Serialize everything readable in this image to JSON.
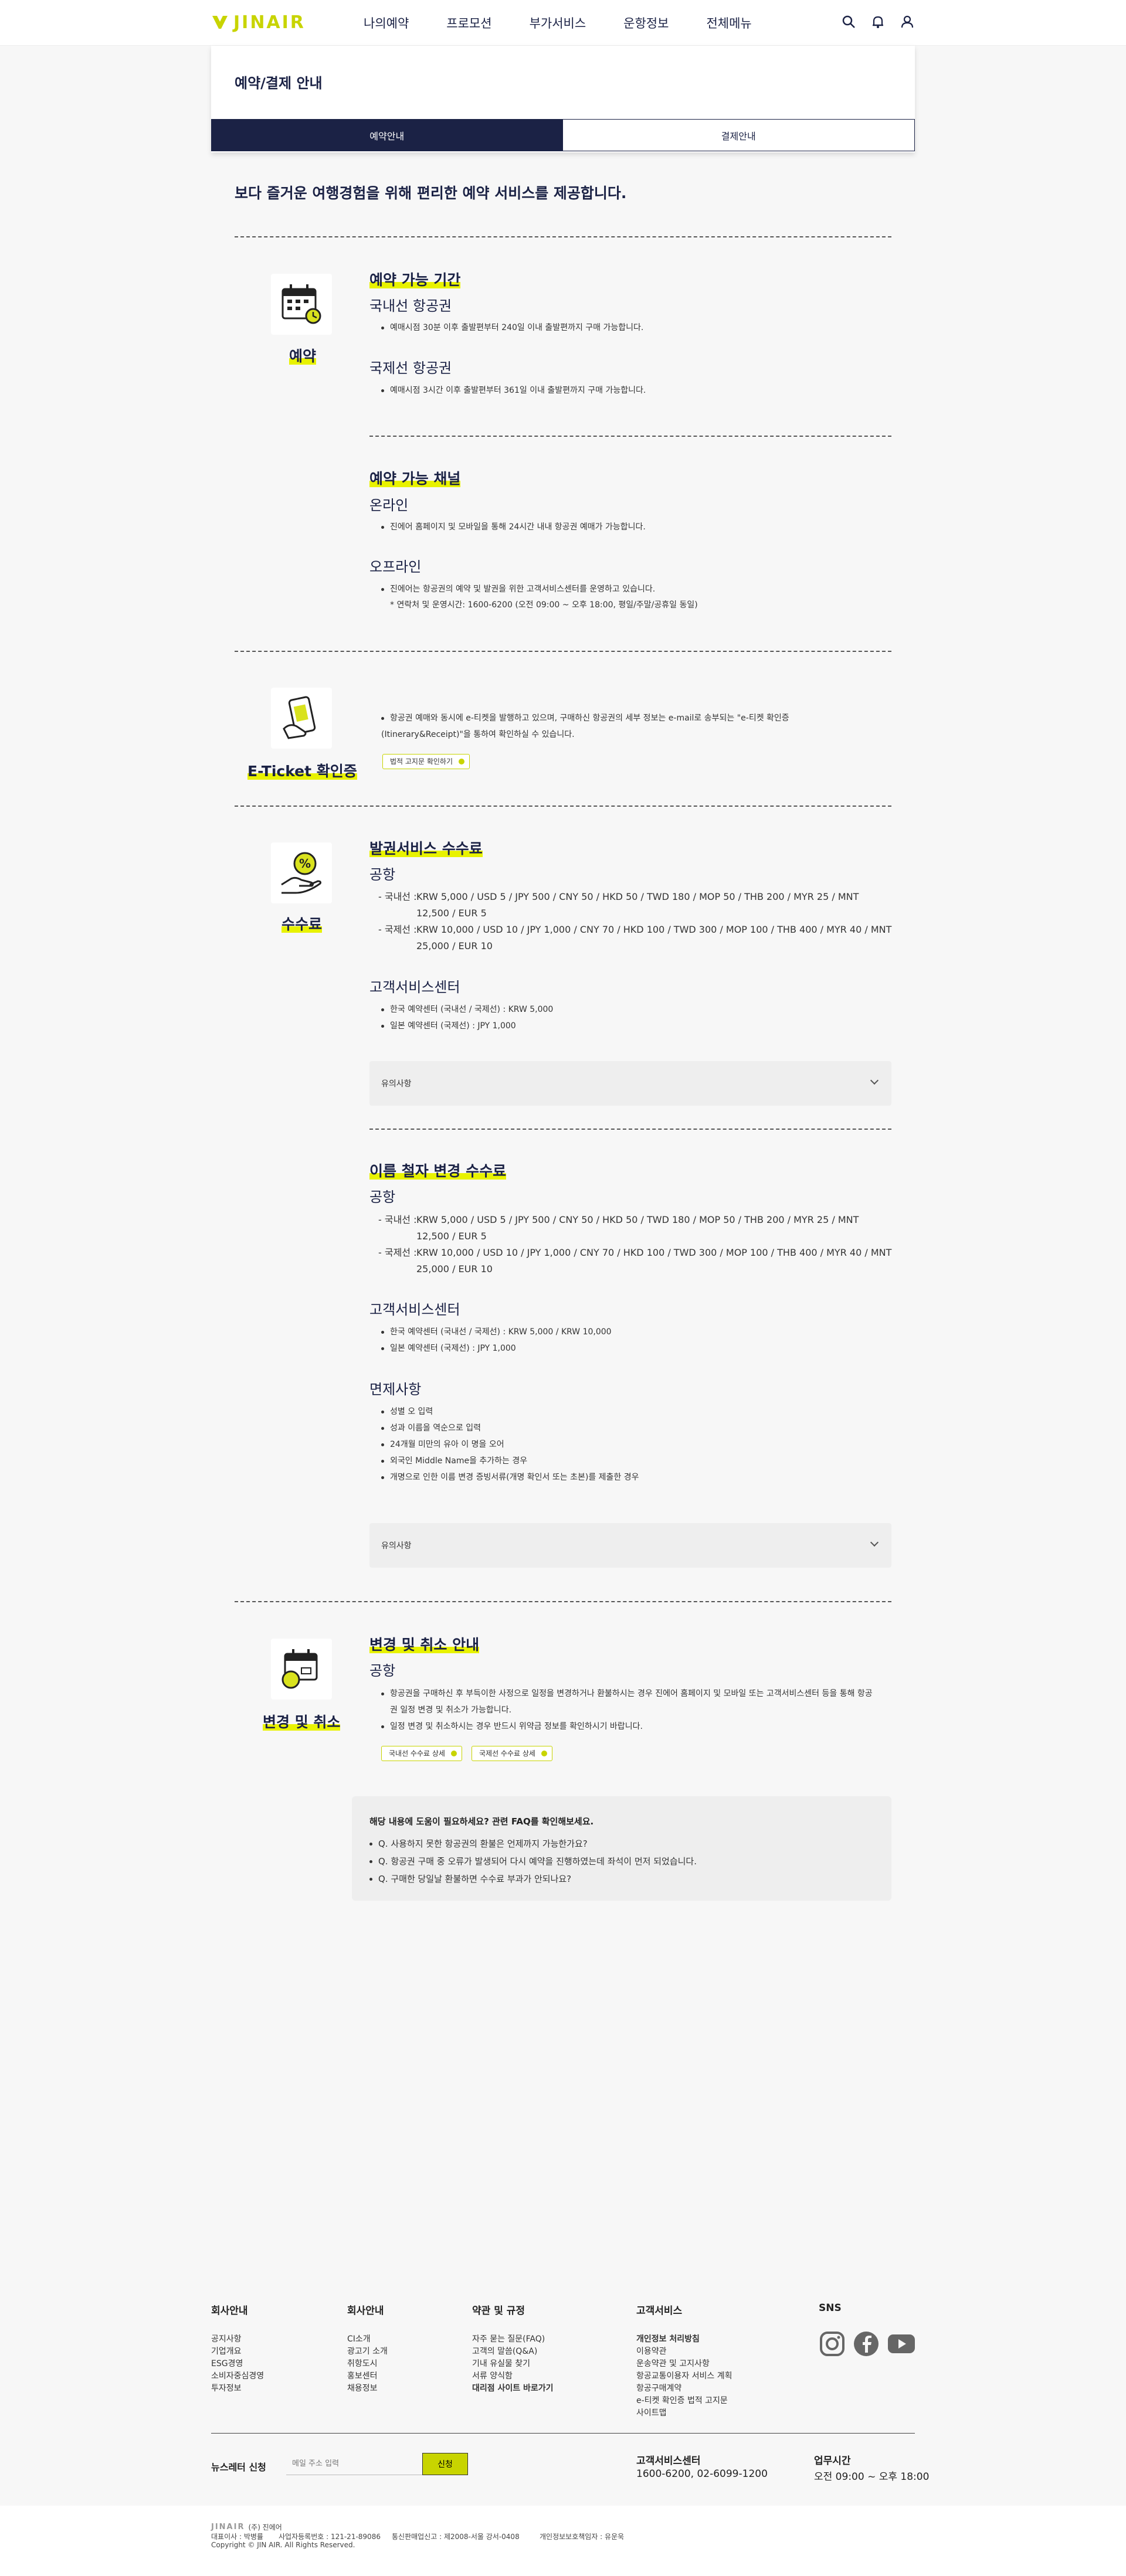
{
  "header": {
    "logo": "JINAIR",
    "nav": [
      "나의예약",
      "프로모션",
      "부가서비스",
      "운항정보",
      "전체메뉴"
    ],
    "icons": [
      "search-icon",
      "bell-icon",
      "user-icon"
    ]
  },
  "page": {
    "title": "예약/결제 안내",
    "tabs": [
      "예약안내",
      "결제안내"
    ],
    "intro": "보다 즐거운 여행경험을 위해 편리한 예약 서비스를 제공합니다."
  },
  "reservation": {
    "label": "예약",
    "period_title": "예약 가능 기간",
    "domestic_title": "국내선 항공권",
    "domestic_text": "예매시점 30분 이후 출발편부터 240일 이내 출발편까지 구매 가능합니다.",
    "intl_title": "국제선 항공권",
    "intl_text": "예매시점 3시간 이후 출발편부터 361일 이내 출발편까지 구매 가능합니다.",
    "channel_title": "예약 가능 채널",
    "online_title": "온라인",
    "online_text": "진에어 홈페이지 및 모바일을 통해 24시간 내내 항공권 예매가 가능합니다.",
    "offline_title": "오프라인",
    "offline_text": "진에어는 항공권의 예약 및 발권을 위한 고객서비스센터를 운영하고 있습니다.",
    "offline_note": "* 연락처 및 운영시간: 1600-6200 (오전 09:00 ~ 오후 18:00, 평일/주말/공휴일 동일)"
  },
  "eticket": {
    "label": "E-Ticket 확인증",
    "text1": "항공권 예매와 동시에 e-티켓을 발행하고 있으며, 구매하신 항공권의 세부 정보는 e-mail로 송부되는 \"e-티켓 확인증",
    "text2": "(Itinerary&Receipt)\"을 통하여 확인하실 수 있습니다.",
    "button": "법적 고지문 확인하기"
  },
  "fee": {
    "label": "수수료",
    "ticketing_title": "발권서비스 수수료",
    "airport_title": "공항",
    "dom_prefix": "- 국내선 :",
    "dom_fee_1": "KRW 5,000 / USD 5 / JPY 500 / CNY 50 / HKD 50 / TWD 180 / MOP 50 / THB 200 / MYR 25 / MNT",
    "dom_fee_2": "12,500 / EUR 5",
    "intl_prefix": "- 국제선 :",
    "intl_fee_1": "KRW 10,000 / USD 10 / JPY 1,000 / CNY 70 / HKD 100 / TWD 300 / MOP 100 / THB 400 / MYR 40 / MNT",
    "intl_fee_2": "25,000 / EUR 10",
    "center_title": "고객서비스센터",
    "center_kr": "한국 예약센터 (국내선 / 국제선) : KRW 5,000",
    "center_jp": "일본 예약센터 (국제선) : JPY 1,000",
    "notice": "유의사항"
  },
  "namefee": {
    "title": "이름 철자 변경 수수료",
    "airport_title": "공항",
    "dom_prefix": "- 국내선 :",
    "dom_fee_1": "KRW 5,000 / USD 5 / JPY 500 / CNY 50 / HKD 50 / TWD 180 / MOP 50 / THB 200 / MYR 25 / MNT",
    "dom_fee_2": "12,500 / EUR 5",
    "intl_prefix": "- 국제선 :",
    "intl_fee_1": "KRW 10,000 / USD 10 / JPY 1,000 / CNY 70 / HKD 100 / TWD 300 / MOP 100 / THB 400 / MYR 40 / MNT",
    "intl_fee_2": "25,000 / EUR 10",
    "center_title": "고객서비스센터",
    "center_kr": "한국 예약센터 (국내선 / 국제선) : KRW 5,000 / KRW 10,000",
    "center_jp": "일본 예약센터 (국제선) : JPY 1,000",
    "exempt_title": "면제사항",
    "exempt": [
      "성별 오 입력",
      "성과 이름을 역순으로 입력",
      "24개월 미만의 유아 이 명을 오어",
      "외국인 Middle Name을 추가하는 경우",
      "개명으로 인한 이름 변경 증빙서류(개명 확인서 또는 초본)를 제출한 경우"
    ],
    "notice": "유의사항"
  },
  "change": {
    "label": "변경 및 취소",
    "title": "변경 및 취소 안내",
    "airport_title": "공항",
    "text1": "항공권을 구매하신 후 부득이한 사정으로 일정을 변경하거나 환불하시는 경우 진에어 홈페이지 및 모바일 또는 고객서비스센터 등을 통해 항공",
    "text1b": "권 일정 변경 및 취소가 가능합니다.",
    "text2": "일정 변경 및 취소하시는 경우 반드시 위약금 정보를 확인하시기 바랍니다.",
    "btn_dom": "국내선 수수료 상세",
    "btn_intl": "국제선 수수료 상세"
  },
  "faq": {
    "title": "해당 내용에 도움이 필요하세요? 관련 FAQ를 확인해보세요.",
    "items": [
      "Q. 사용하지 못한 항공권의 환불은 언제까지 가능한가요?",
      "Q. 항공권 구매 중 오류가 발생되어 다시 예약을 진행하였는데 좌석이 먼저 되었습니다.",
      "Q. 구매한 당일날 환불하면 수수료 부과가 안되나요?"
    ]
  },
  "footer": {
    "cols": [
      {
        "title": "회사안내",
        "links": [
          "공지사항",
          "기업개요",
          "ESG경영",
          "소비자중심경영",
          "투자정보"
        ]
      },
      {
        "title": "회사안내",
        "links": [
          "CI소개",
          "광고기 소개",
          "취항도시",
          "홍보센터",
          "채용정보"
        ]
      },
      {
        "title": "약관 및 규정",
        "links": [
          "자주 묻는 질문(FAQ)",
          "고객의 말씀(Q&A)",
          "기내 유실물 찾기",
          "서류 양식함",
          "대리점 사이트 바로가기"
        ]
      },
      {
        "title": "고객서비스",
        "links": [
          "개인정보 처리방침",
          "이용약관",
          "운송약관 및 고지사항",
          "항공교통이용자 서비스 계획",
          "항공구매계약",
          "e-티켓 확인증 법적 고지문",
          "사이트맵"
        ]
      },
      {
        "title": "SNS",
        "links": []
      }
    ],
    "newsletter_label": "뉴스레터 신청",
    "newsletter_placeholder": "메일 주소 입력",
    "newsletter_button": "신청",
    "cs_title": "고객서비스센터",
    "cs_phone": "1600-6200, 02-6099-1200",
    "hours_title": "업무시간",
    "hours_value": "오전 09:00 ~ 오후 18:00",
    "company": "(주) 진에어",
    "info1": "대표이사 : 박병률",
    "info2": "사업자등록번호 : 121-21-89086",
    "info3": "통신판매업신고 : 제2008-서울 강서-0408",
    "info4": "개인정보보호책임자 : 유운욱",
    "copyright": "Copyright © JIN AIR. All Rights Reserved."
  },
  "colors": {
    "navy": "#1b2245",
    "accent": "#c8d400"
  }
}
